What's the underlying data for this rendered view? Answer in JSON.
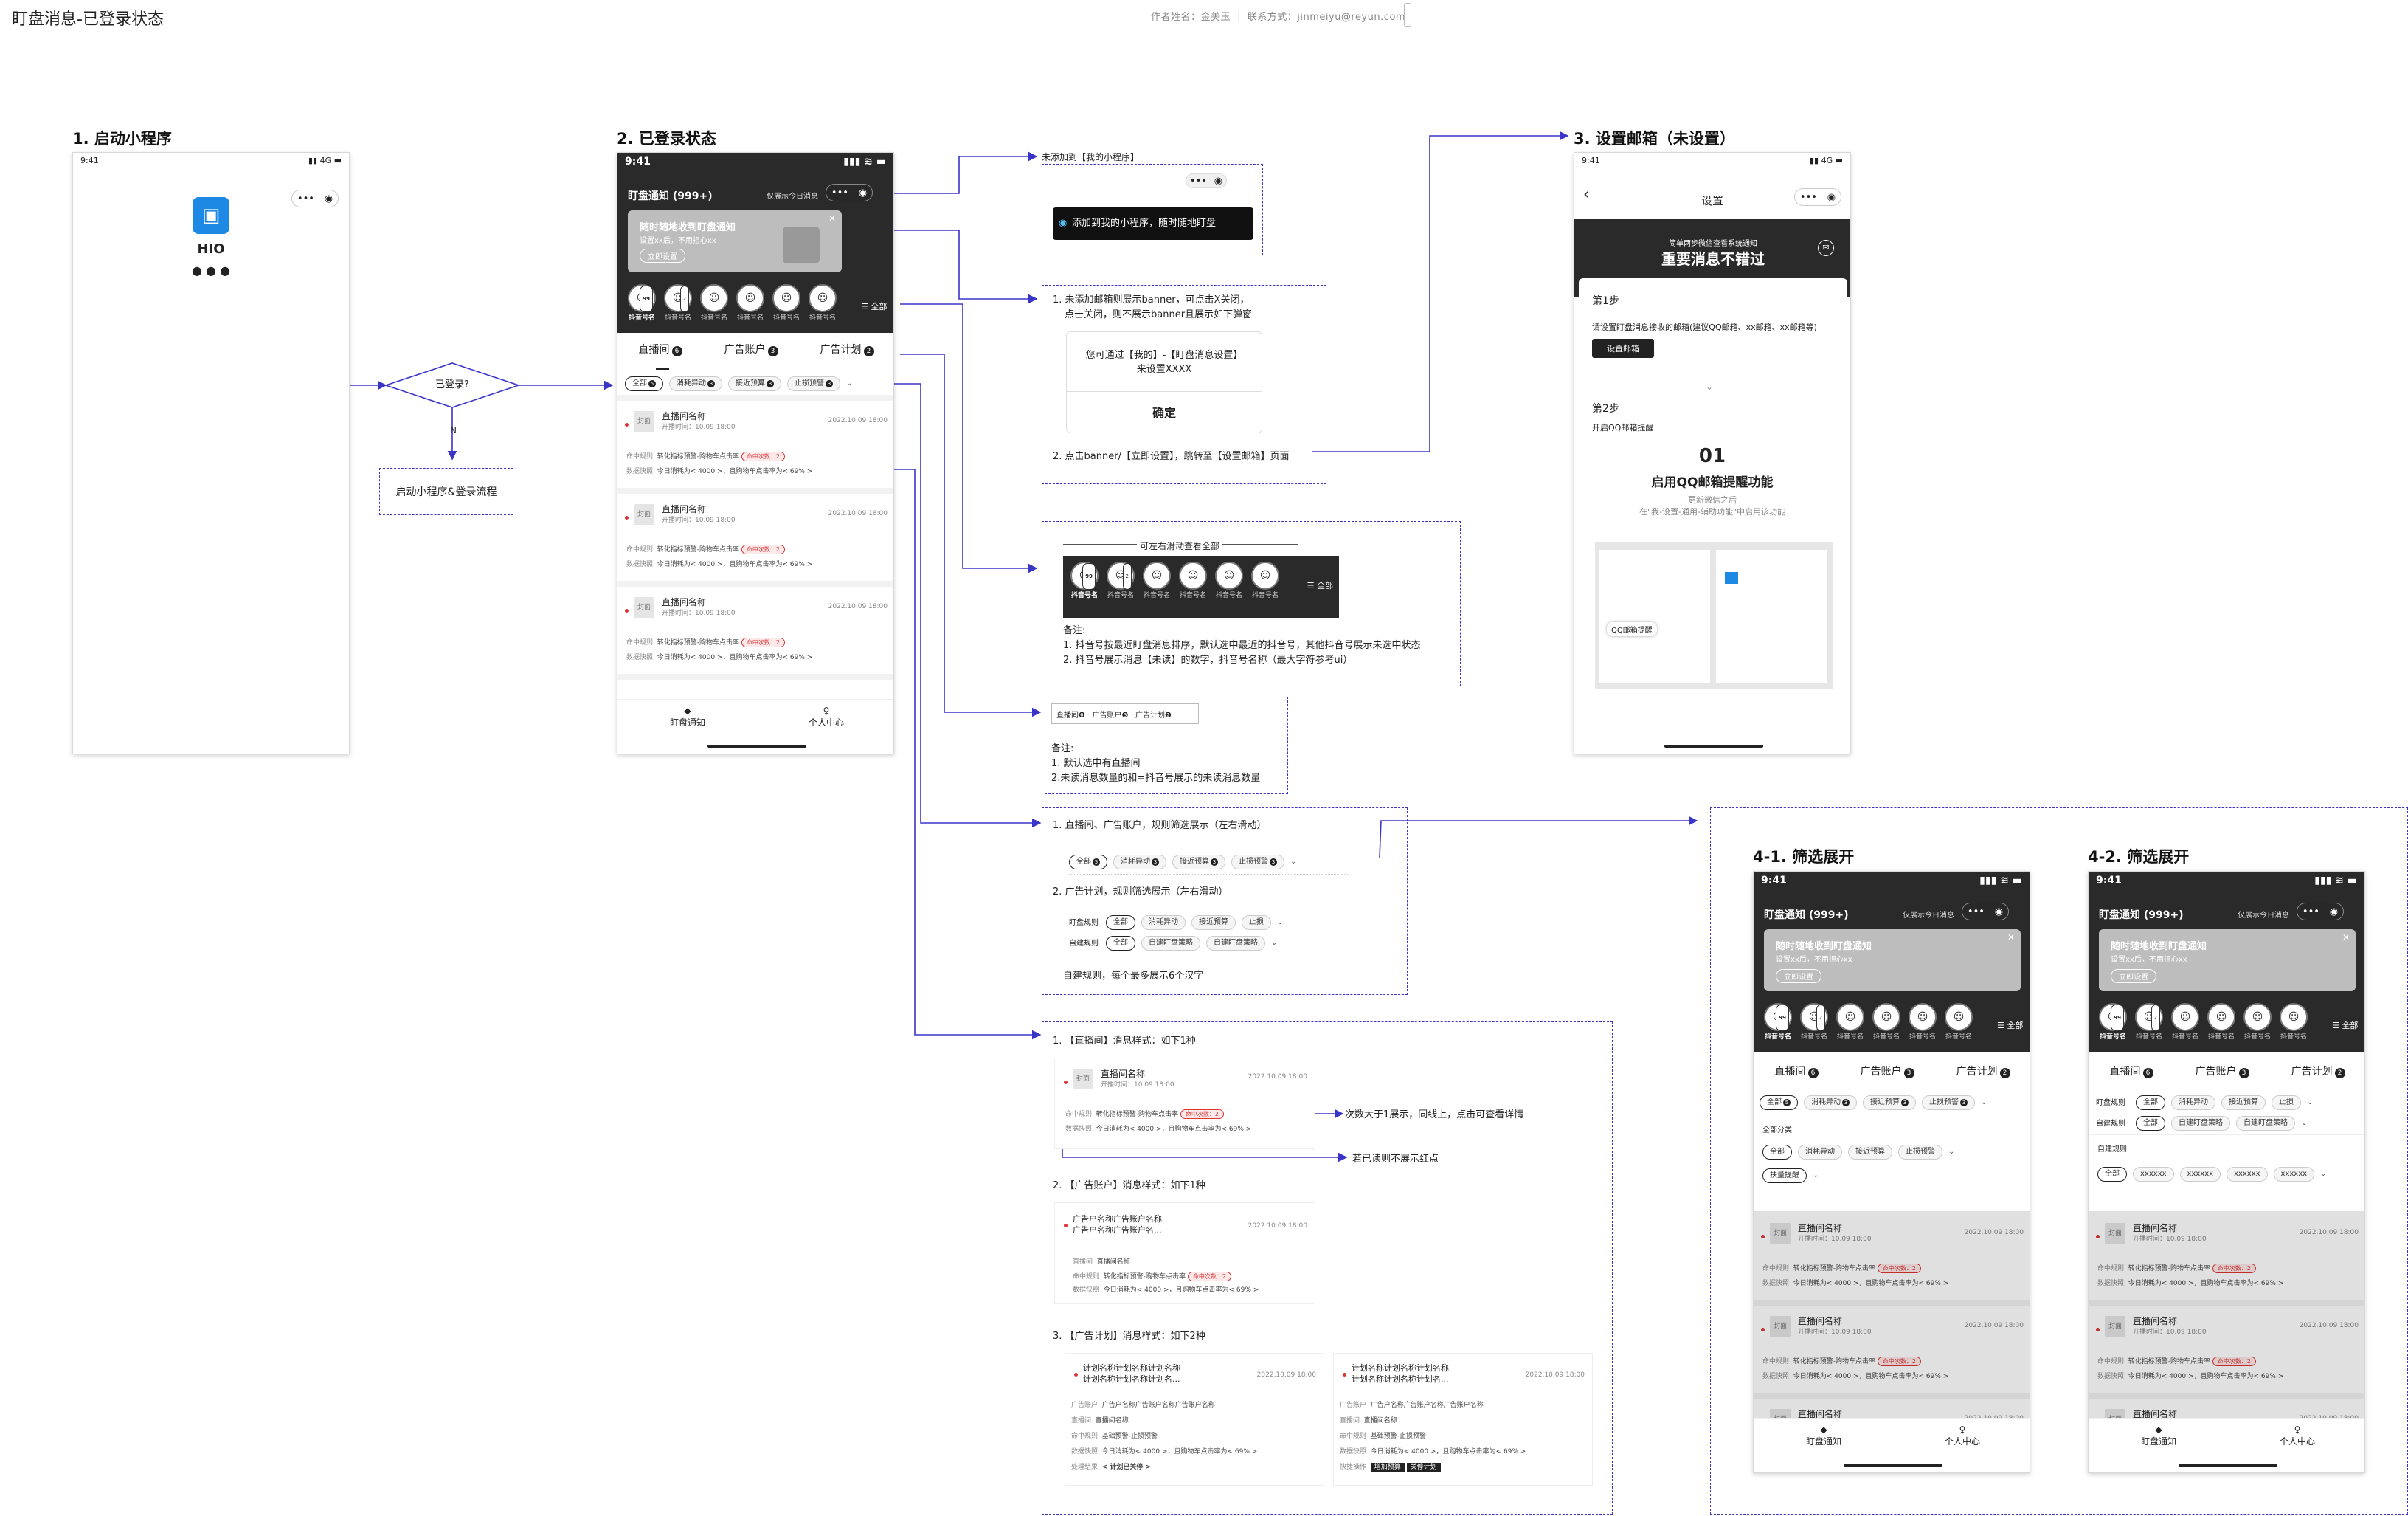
{
  "page": {
    "title": "盯盘消息-已登录状态",
    "author": "作者姓名：金美玉 ｜ 联系方式：jinmeiyu@reyun.com"
  },
  "sections": {
    "s1": "1. 启动小程序",
    "s2": "2. 已登录状态",
    "s3": "3. 设置邮箱（未设置）",
    "s41": "4-1. 筛选展开",
    "s42": "4-2. 筛选展开"
  },
  "status": {
    "time": "9:41",
    "signal": "4G"
  },
  "launch": {
    "app_name": "HIO",
    "dots": "● ● ●"
  },
  "flow": {
    "decision": "已登录?",
    "no_label": "N",
    "fallback": "启动小程序&登录流程"
  },
  "main": {
    "nav_title": "盯盘通知 (999+)",
    "nav_hint": "仅展示今日消息",
    "banner_title": "随时随地收到盯盘通知",
    "banner_sub": "设置xx后，不用担心xx",
    "banner_btn": "立即设置",
    "accounts": [
      {
        "name": "抖音号名",
        "badge": "99"
      },
      {
        "name": "抖音号名",
        "badge": "2"
      },
      {
        "name": "抖音号名",
        "badge": ""
      },
      {
        "name": "抖音号名",
        "badge": ""
      },
      {
        "name": "抖音号名",
        "badge": ""
      },
      {
        "name": "抖音号名",
        "badge": ""
      }
    ],
    "all_label": "☰ 全部",
    "tabs": [
      {
        "label": "直播间",
        "count": "6"
      },
      {
        "label": "广告账户",
        "count": "3"
      },
      {
        "label": "广告计划",
        "count": "2"
      }
    ],
    "chips": [
      {
        "label": "全部",
        "count": "5",
        "on": true
      },
      {
        "label": "消耗异动",
        "count": "3"
      },
      {
        "label": "接近预算",
        "count": "3"
      },
      {
        "label": "止损预警",
        "count": "3"
      }
    ],
    "cards": [
      {
        "cover": "封面",
        "name": "直播间名称",
        "sub": "开播时间：10.09 18:00",
        "time": "2022.10.09 18:00",
        "rule_k": "命中规则",
        "rule_v": "转化指标预警-购物车点击率",
        "badge": "命中次数：2",
        "fast_k": "数据快照",
        "fast_v": "今日消耗为< 4000 >，且购物车点击率为< 69% >"
      },
      {
        "cover": "封面",
        "name": "直播间名称",
        "sub": "开播时间：10.09 18:00",
        "time": "2022.10.09 18:00",
        "rule_k": "命中规则",
        "rule_v": "转化指标预警-购物车点击率",
        "badge": "命中次数：2",
        "fast_k": "数据快照",
        "fast_v": "今日消耗为< 4000 >，且购物车点击率为< 69% >"
      },
      {
        "cover": "封面",
        "name": "直播间名称",
        "sub": "开播时间：10.09 18:00",
        "time": "2022.10.09 18:00",
        "rule_k": "命中规则",
        "rule_v": "转化指标预警-购物车点击率",
        "badge": "命中次数：2",
        "fast_k": "数据快照",
        "fast_v": "今日消耗为< 4000 >，且购物车点击率为< 69% >"
      }
    ],
    "bottom_tabs": [
      "盯盘通知",
      "个人中心"
    ]
  },
  "notes": {
    "mini_title": "未添加到【我的小程序】",
    "mini_tip": "添加到我的小程序，随时随地盯盘",
    "banner_note_1": "1. 未添加邮箱则展示banner，可点击X关闭，",
    "banner_note_1b": "点击关闭，则不展示banner且展示如下弹窗",
    "dialog_text": "您可通过【我的】-【盯盘消息设置】",
    "dialog_text2": "来设置XXXX",
    "dialog_btn": "确定",
    "banner_note_2": "2. 点击banner/【立即设置】，跳转至【设置邮箱】页面",
    "scroll_label": "可左右滑动查看全部",
    "acct_note_title": "备注:",
    "acct_note_1": "1. 抖音号按最近盯盘消息排序，默认选中最近的抖音号，其他抖音号展示未选中状态",
    "acct_note_2": "2. 抖音号展示消息【未读】的数字，抖音号名称（最大字符参考ui）",
    "tab_note_title": "备注:",
    "tab_note_1": "1. 默认选中有直播间",
    "tab_note_2": "2.未读消息数量的和=抖音号展示的未读消息数量",
    "filter_note_1": "1. 直播间、广告账户，规则筛选展示（左右滑动）",
    "filter_note_2": "2. 广告计划，规则筛选展示（左右滑动）",
    "filter_row1_label": "盯盘规则",
    "filter_row2_label": "自建规则",
    "filter_row1": [
      "全部",
      "消耗异动",
      "接近预算",
      "止损"
    ],
    "filter_row2": [
      "全部",
      "自建盯盘策略",
      "自建盯盘策略"
    ],
    "filter_note_3": "自建规则，每个最多展示6个汉字",
    "style_1": "1. 【直播间】消息样式：如下1种",
    "style_2": "2. 【广告账户】消息样式：如下1种",
    "style_3": "3. 【广告计划】消息样式：如下2种",
    "arrow_1": "次数大于1展示，同线上，点击可查看详情",
    "arrow_2": "若已读则不展示红点",
    "acct_card_title": "广告户名称广告账户名称",
    "acct_card_title2": "广告户名称广告账户名...",
    "acct_card_k1": "直播间",
    "acct_card_v1": "直播间名称",
    "plan_title": "计划名称计划名称计划名称",
    "plan_title2": "计划名称计划名称计划名...",
    "plan_k_acct": "广告账户",
    "plan_v_acct": "广告户名称广告账户名称广告账户名称",
    "plan_k_room": "直播间",
    "plan_v_room": "直播间名称",
    "plan_rule_v": "基础预警-止损预警",
    "plan_k_res": "处理结果",
    "plan_v_res": "< 计划已关停 >",
    "plan_k_op": "快捷操作",
    "plan_op1": "增加预算",
    "plan_op2": "关停计划"
  },
  "settings": {
    "nav_title": "设置",
    "header_small": "简单两步微信查看系统通知",
    "header_big": "重要消息不错过",
    "step1": "第1步",
    "step1_desc": "请设置盯盘消息接收的邮箱(建议QQ邮箱、xx邮箱、xx邮箱等)",
    "step1_btn": "设置邮箱",
    "step2": "第2步",
    "step2_desc": "开启QQ邮箱提醒",
    "num": "01",
    "feature": "启用QQ邮箱提醒功能",
    "hint1": "更新微信之后",
    "hint2": "在\"我-设置-通用-辅助功能\"中启用该功能",
    "qq_label": "QQ邮箱提醒"
  },
  "expand": {
    "group_label": "全部分类",
    "row1": [
      "全部",
      "消耗异动",
      "接近预算",
      "止损预警"
    ],
    "row2": [
      "扶量提醒"
    ],
    "rule_label": "自建规则",
    "rule_items": [
      "全部",
      "xxxxxx",
      "xxxxxx",
      "xxxxxx",
      "xxxxxx"
    ]
  }
}
